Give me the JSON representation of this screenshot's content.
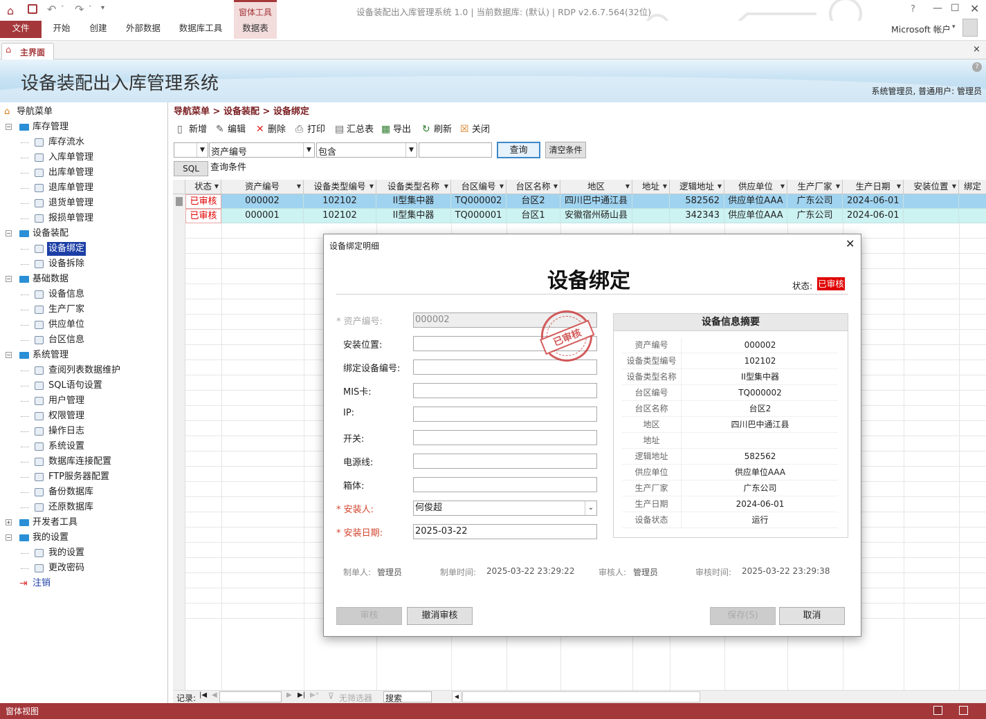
{
  "window": {
    "title": "设备装配出入库管理系统 1.0 | 当前数据库: (默认) | RDP v2.6.7.564(32位)",
    "account": "Microsoft 帐户",
    "help": "?"
  },
  "ribbon": {
    "file": "文件",
    "tabs": [
      "开始",
      "创建",
      "外部数据",
      "数据库工具"
    ],
    "context_group": "窗体工具",
    "context_tab": "数据表"
  },
  "doctab": {
    "label": "主界面",
    "close": "×"
  },
  "header": {
    "app_title": "设备装配出入库管理系统",
    "user_info": "系统管理员, 普通用户: 管理员"
  },
  "sidebar": {
    "root": "导航菜单",
    "groups": [
      {
        "label": "库存管理",
        "items": [
          "库存流水",
          "入库单管理",
          "出库单管理",
          "退库单管理",
          "退货单管理",
          "报损单管理"
        ]
      },
      {
        "label": "设备装配",
        "items": [
          "设备绑定",
          "设备拆除"
        ]
      },
      {
        "label": "基础数据",
        "items": [
          "设备信息",
          "生产厂家",
          "供应单位",
          "台区信息"
        ]
      },
      {
        "label": "系统管理",
        "items": [
          "查阅列表数据维护",
          "SQL语句设置",
          "用户管理",
          "权限管理",
          "操作日志",
          "系统设置",
          "数据库连接配置",
          "FTP服务器配置",
          "备份数据库",
          "还原数据库"
        ]
      },
      {
        "label": "开发者工具",
        "items": []
      },
      {
        "label": "我的设置",
        "items": [
          "我的设置",
          "更改密码"
        ]
      }
    ],
    "logout": "注销"
  },
  "breadcrumb": "导航菜单 > 设备装配 > 设备绑定",
  "toolbar": [
    "新增",
    "编辑",
    "删除",
    "打印",
    "汇总表",
    "导出",
    "刷新",
    "关闭"
  ],
  "filter": {
    "field": "资产编号",
    "operator": "包含",
    "value": "",
    "query_btn": "查询",
    "clear_btn": "清空条件",
    "sql_btn": "SQL",
    "sql_text": "查询条件"
  },
  "grid": {
    "columns": [
      "状态",
      "资产编号",
      "设备类型编号",
      "设备类型名称",
      "台区编号",
      "台区名称",
      "地区",
      "地址",
      "逻辑地址",
      "供应单位",
      "生产厂家",
      "生产日期",
      "安装位置",
      "绑定"
    ],
    "rows": [
      [
        "已审核",
        "000002",
        "102102",
        "II型集中器",
        "TQ000002",
        "台区2",
        "四川巴中通江县",
        "",
        "582562",
        "供应单位AAA",
        "广东公司",
        "2024-06-01",
        "",
        ""
      ],
      [
        "已审核",
        "000001",
        "102102",
        "II型集中器",
        "TQ000001",
        "台区1",
        "安徽宿州砀山县",
        "",
        "342343",
        "供应单位AAA",
        "广东公司",
        "2024-06-01",
        "",
        ""
      ]
    ]
  },
  "recordnav": {
    "label": "记录:",
    "no_filter": "无筛选器",
    "search": "搜索"
  },
  "statusbar": {
    "text": "窗体视图"
  },
  "dialog": {
    "title": "设备绑定明细",
    "heading": "设备绑定",
    "status_label": "状态:",
    "status_value": "已审核",
    "stamp": "已审核",
    "fields": {
      "asset_no_label": "* 资产编号:",
      "asset_no": "000002",
      "install_pos_label": "安装位置:",
      "install_pos": "",
      "bind_dev_label": "绑定设备编号:",
      "bind_dev": "",
      "mis_label": "MIS卡:",
      "mis": "",
      "ip_label": "IP:",
      "ip": "",
      "switch_label": "开关:",
      "switch": "",
      "power_label": "电源线:",
      "power": "",
      "box_label": "箱体:",
      "box": "",
      "installer_label": "* 安装人:",
      "installer": "何俊超",
      "install_date_label": "* 安装日期:",
      "install_date": "2025-03-22"
    },
    "summary_title": "设备信息摘要",
    "summary": [
      [
        "资产编号",
        "000002"
      ],
      [
        "设备类型编号",
        "102102"
      ],
      [
        "设备类型名称",
        "II型集中器"
      ],
      [
        "台区编号",
        "TQ000002"
      ],
      [
        "台区名称",
        "台区2"
      ],
      [
        "地区",
        "四川巴中通江县"
      ],
      [
        "地址",
        ""
      ],
      [
        "逻辑地址",
        "582562"
      ],
      [
        "供应单位",
        "供应单位AAA"
      ],
      [
        "生产厂家",
        "广东公司"
      ],
      [
        "生产日期",
        "2024-06-01"
      ],
      [
        "设备状态",
        "运行"
      ]
    ],
    "meta": {
      "maker_label": "制单人:",
      "maker": "管理员",
      "make_time_label": "制单时间:",
      "make_time": "2025-03-22 23:29:22",
      "auditor_label": "审核人:",
      "auditor": "管理员",
      "audit_time_label": "审核时间:",
      "audit_time": "2025-03-22 23:29:38"
    },
    "buttons": {
      "audit": "审核",
      "unaudit": "撤消审核",
      "save": "保存(S)",
      "cancel": "取消"
    }
  },
  "colors": {
    "accent": "#a4373a",
    "header_text": "#333333",
    "breadcrumb": "#7a1f22",
    "selected_row": "#9fd3f0",
    "row_bg": "#ccf2f2",
    "status_red": "#e00000"
  }
}
